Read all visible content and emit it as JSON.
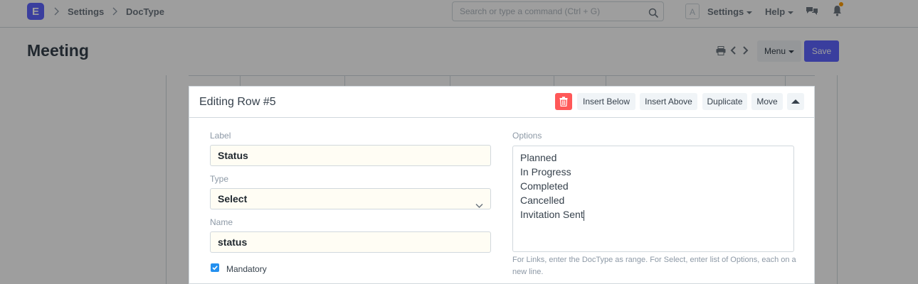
{
  "navbar": {
    "logo_letter": "E",
    "breadcrumbs": [
      "Settings",
      "DocType"
    ],
    "search_placeholder": "Search or type a command (Ctrl + G)",
    "avatar_letter": "A",
    "settings_label": "Settings",
    "help_label": "Help",
    "notification_dot_color": "#ff9d00"
  },
  "page": {
    "title": "Meeting",
    "menu_label": "Menu",
    "save_label": "Save",
    "primary_color": "#5e64ff"
  },
  "row_editor": {
    "title": "Editing Row #5",
    "buttons": {
      "insert_below": "Insert Below",
      "insert_above": "Insert Above",
      "duplicate": "Duplicate",
      "move": "Move"
    },
    "fields": {
      "label": {
        "label": "Label",
        "value": "Status"
      },
      "type": {
        "label": "Type",
        "value": "Select"
      },
      "name": {
        "label": "Name",
        "value": "status"
      },
      "options": {
        "label": "Options",
        "lines": [
          "Planned",
          "In Progress",
          "Completed",
          "Cancelled",
          "Invitation Sent"
        ],
        "help": "For Links, enter the DocType as range. For Select, enter list of Options, each on a new line."
      },
      "mandatory": {
        "label": "Mandatory",
        "checked": true
      }
    }
  }
}
